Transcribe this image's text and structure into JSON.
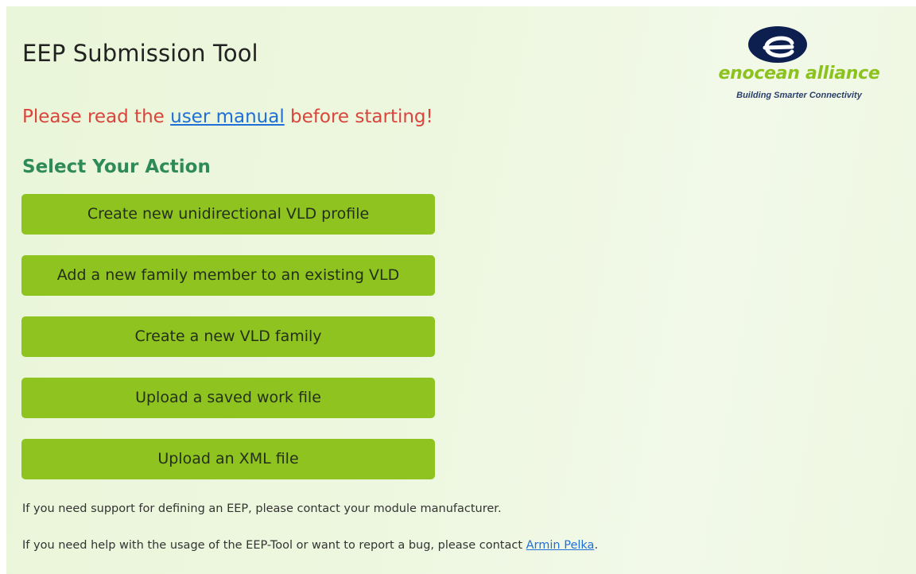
{
  "page": {
    "title": "EEP Submission Tool"
  },
  "logo": {
    "wordmark": "enocean alliance",
    "tagline": "Building Smarter Connectivity",
    "colors": {
      "mark_outer": "#0d1f4f",
      "mark_inner": "#ffffff",
      "wordmark": "#8cc21e",
      "tagline": "#2b3f6b"
    }
  },
  "notice": {
    "prefix": "Please read the ",
    "link_text": "user manual",
    "suffix": " before starting!"
  },
  "actions": {
    "heading": "Select Your Action",
    "buttons": [
      {
        "label": "Create new unidirectional VLD profile"
      },
      {
        "label": "Add a new family member to an existing VLD"
      },
      {
        "label": "Create a new VLD family"
      },
      {
        "label": "Upload a saved work file"
      },
      {
        "label": "Upload an XML file"
      }
    ]
  },
  "support": {
    "line1": "If you need support for defining an EEP, please contact your module manufacturer.",
    "line2_prefix": "If you need help with the usage of the EEP-Tool or want to report a bug, please contact ",
    "line2_link": "Armin Pelka",
    "line2_suffix": "."
  },
  "colors": {
    "background": "#edf7df",
    "button": "#8fc31f",
    "warning": "#d9453c",
    "section_heading": "#2e8b57",
    "link": "#1f6fd6"
  }
}
